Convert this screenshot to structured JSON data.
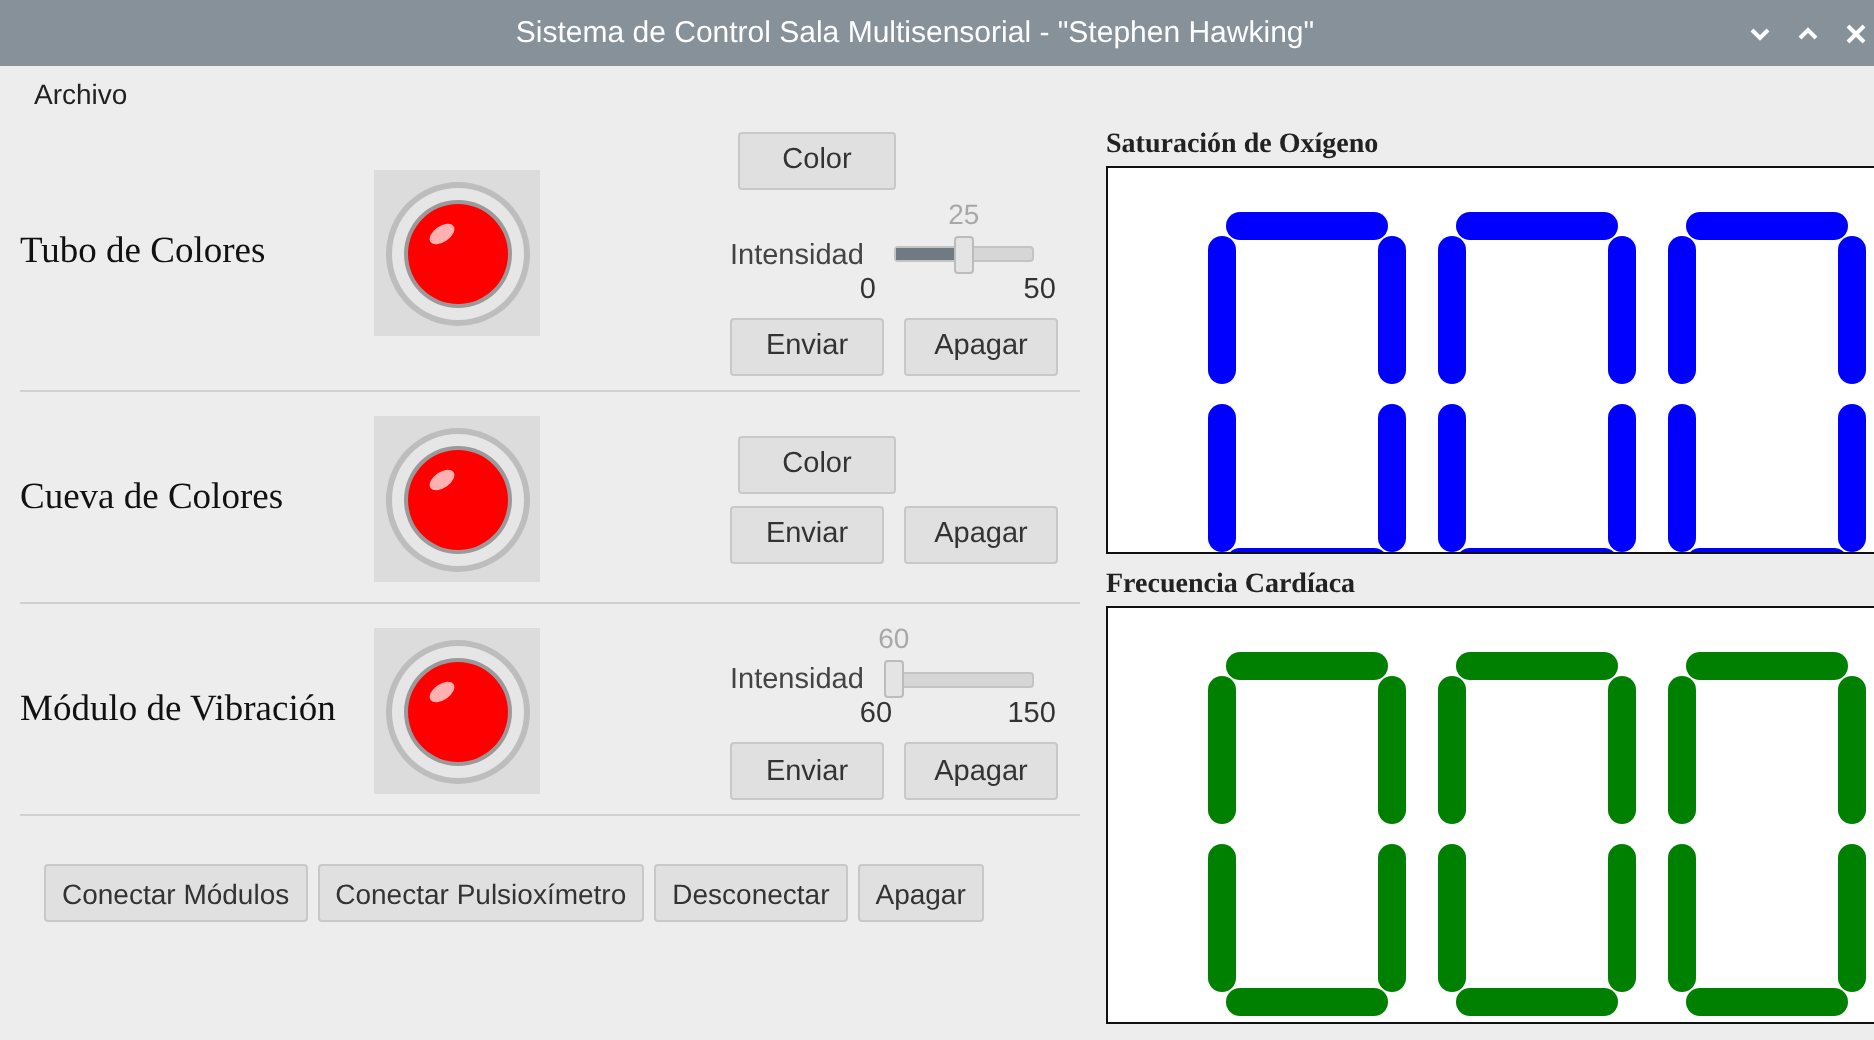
{
  "window": {
    "title": "Sistema de Control Sala Multisensorial - \"Stephen Hawking\""
  },
  "menu": [
    "Archivo"
  ],
  "modules": [
    {
      "name": "Tubo de Colores",
      "color_button": "Color",
      "slider": {
        "label": "Intensidad",
        "value": "25",
        "min": "0",
        "max": "50",
        "level": 0.5
      },
      "buttons": [
        "Enviar",
        "Apagar"
      ]
    },
    {
      "name": "Cueva de Colores",
      "color_button": "Color",
      "buttons": [
        "Enviar",
        "Apagar"
      ]
    },
    {
      "name": "Módulo de Vibración",
      "slider": {
        "label": "Intensidad",
        "value": "60",
        "min": "60",
        "max": "150",
        "level": 0
      },
      "buttons": [
        "Enviar",
        "Apagar"
      ]
    }
  ],
  "footer_buttons": [
    "Conectar Módulos",
    "Conectar Pulsioxímetro",
    "Desconectar",
    "Apagar"
  ],
  "displays": [
    {
      "title": "Saturación de Oxígeno",
      "color": "#0000ff"
    },
    {
      "title": "Frecuencia Cardíaca",
      "color": "#008000"
    }
  ]
}
